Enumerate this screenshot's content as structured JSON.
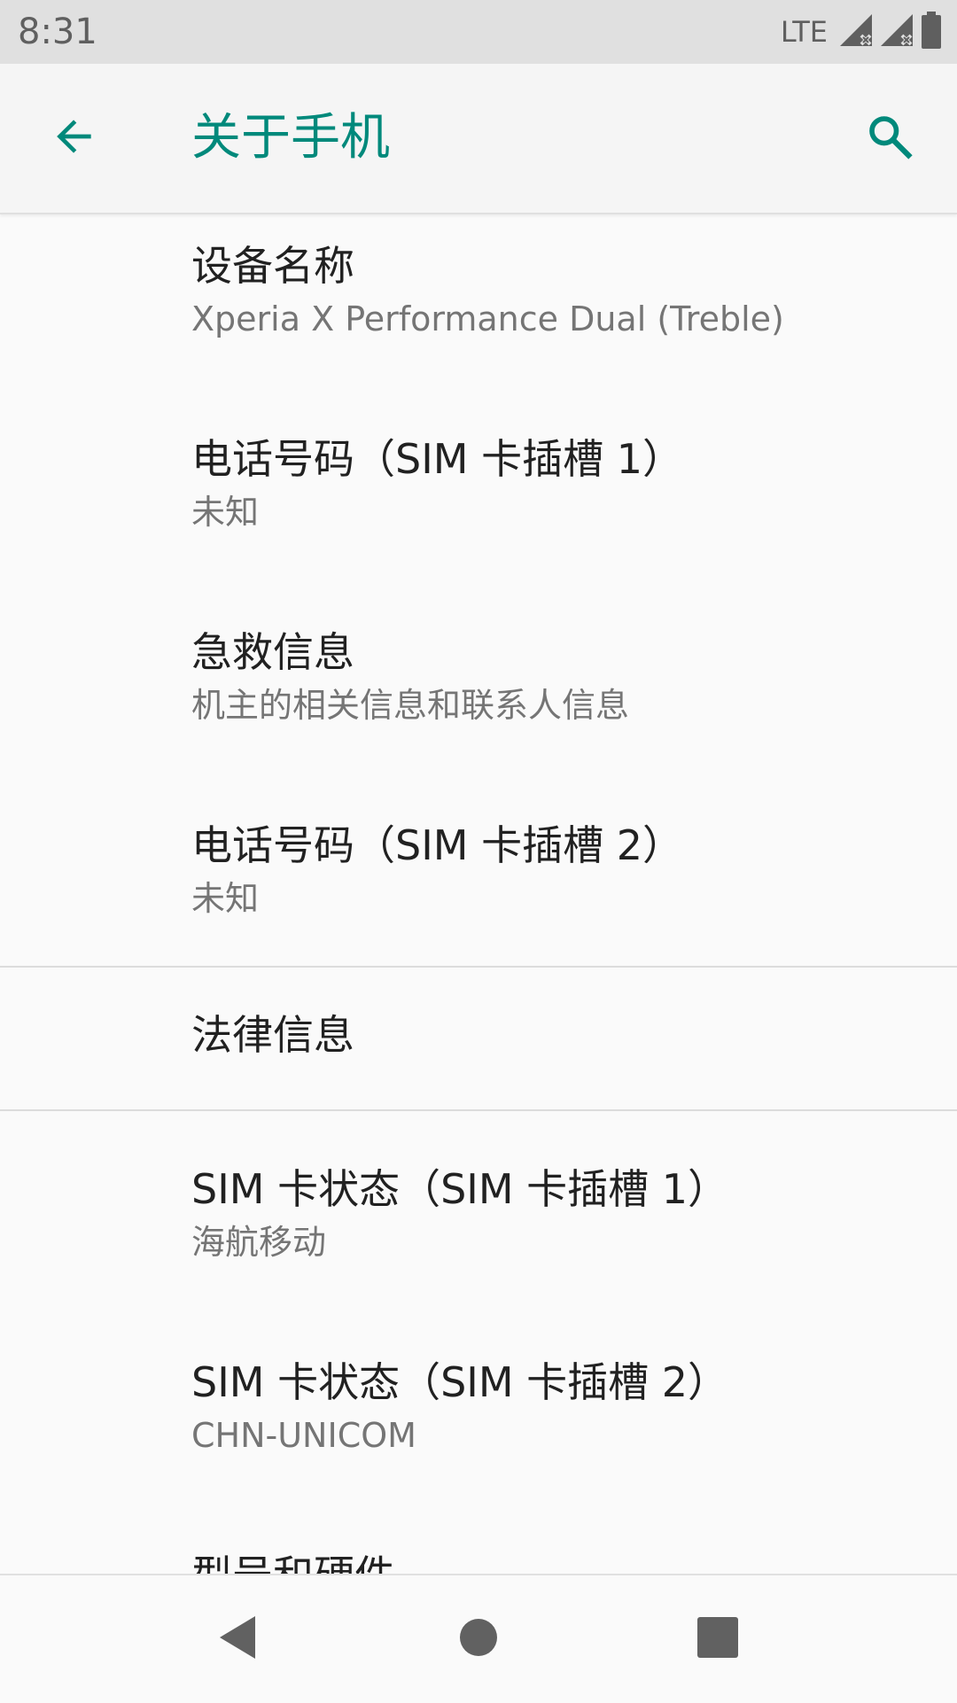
{
  "status_bar": {
    "time": "8:31",
    "network": "LTE",
    "icons": [
      "signal-icon",
      "signal-icon",
      "battery-icon"
    ]
  },
  "app_bar": {
    "title": "关于手机",
    "back_icon": "back-arrow-icon",
    "search_icon": "search-icon"
  },
  "colors": {
    "accent": "#00897b",
    "status_bar_bg": "#e0e0e0",
    "background": "#fafafa",
    "title_text": "#212121",
    "secondary_text": "#757575"
  },
  "items": [
    {
      "title": "设备名称",
      "subtitle": "Xperia X Performance Dual (Treble)"
    },
    {
      "title": "电话号码（SIM 卡插槽 1）",
      "subtitle": "未知"
    },
    {
      "title": "急救信息",
      "subtitle": "机主的相关信息和联系人信息"
    },
    {
      "title": "电话号码（SIM 卡插槽 2）",
      "subtitle": "未知"
    },
    {
      "title": "法律信息",
      "subtitle": ""
    },
    {
      "title": "SIM 卡状态（SIM 卡插槽 1）",
      "subtitle": "海航移动"
    },
    {
      "title": "SIM 卡状态（SIM 卡插槽 2）",
      "subtitle": "CHN-UNICOM"
    },
    {
      "title": "型号和硬件",
      "subtitle": ""
    }
  ],
  "nav_bar": {
    "icons": [
      "back-triangle-icon",
      "home-circle-icon",
      "recents-square-icon"
    ]
  }
}
